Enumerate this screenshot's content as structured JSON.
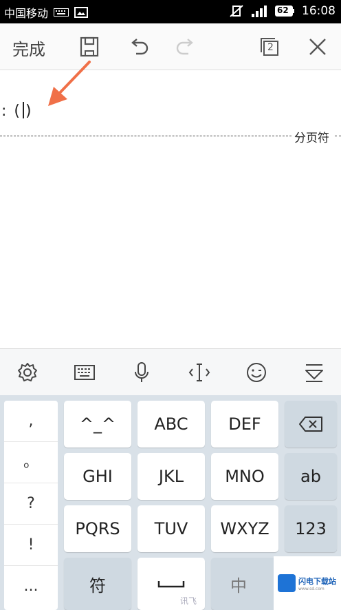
{
  "status_bar": {
    "carrier": "中国移动",
    "battery": "62",
    "time": "16:08"
  },
  "toolbar": {
    "done_label": "完成",
    "page_count": "2"
  },
  "document": {
    "text_before": ": (",
    "text_after": ")",
    "page_break_label": "分页符"
  },
  "keyboard": {
    "symbols": [
      ",",
      "。",
      "?",
      "!",
      "..."
    ],
    "keys_row1": [
      "^_^",
      "ABC",
      "DEF"
    ],
    "keys_row2": [
      "GHI",
      "JKL",
      "MNO"
    ],
    "keys_row3": [
      "PQRS",
      "TUV",
      "WXYZ"
    ],
    "mode_ab": "ab",
    "mode_123": "123",
    "symbol_key": "符",
    "lang_key": "中",
    "space_hint": "讯飞"
  },
  "watermark": {
    "name": "闪电下载站",
    "url": "www.sd.com"
  },
  "colors": {
    "arrow": "#f07048",
    "keyboard_bg": "#d9e1e8",
    "watermark_blue": "#1e73d6"
  }
}
